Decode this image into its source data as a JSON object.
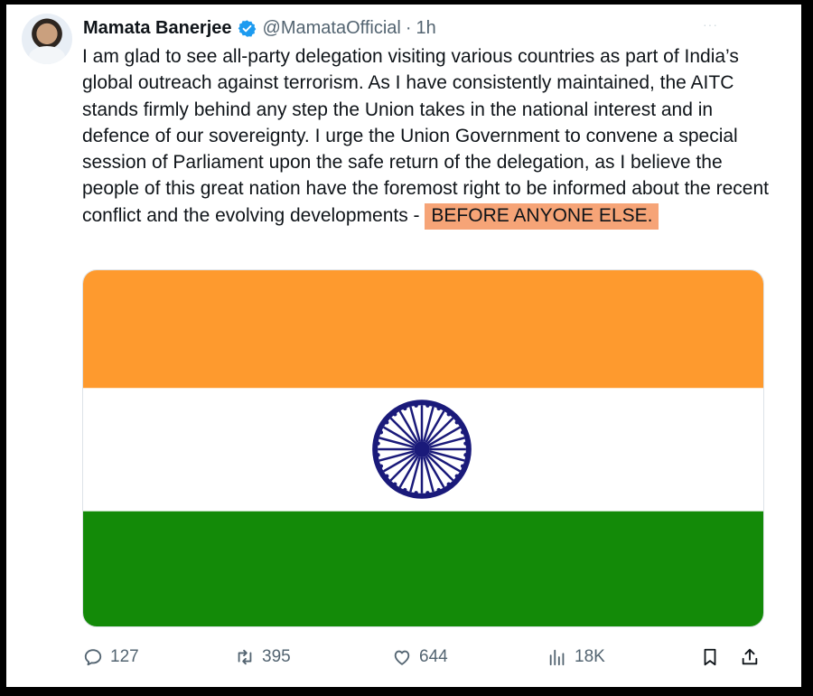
{
  "post": {
    "author_name": "Mamata Banerjee",
    "handle": "@MamataOfficial",
    "separator": "·",
    "timestamp": "1h",
    "text_main": "I am glad to see all-party delegation visiting various countries as part of India’s global outreach against terrorism. As I have consistently maintained, the AITC stands firmly behind any step the Union takes in the national interest and in defence of our sovereignty. I urge the Union Government to convene a special session of Parliament upon the safe return of the delegation, as I believe the people of this great nation have the foremost right to be informed about the recent conflict and the evolving developments - ",
    "text_highlight": "BEFORE ANYONE ELSE."
  },
  "media": {
    "type": "indian-flag",
    "colors": {
      "saffron": "#fe9a2e",
      "white": "#ffffff",
      "green": "#138a08",
      "chakra": "#1a1a7a"
    }
  },
  "actions": {
    "replies": "127",
    "reposts": "395",
    "likes": "644",
    "views": "18K"
  },
  "icons": [
    "verified-badge-icon",
    "reply-icon",
    "repost-icon",
    "like-icon",
    "views-icon",
    "bookmark-icon",
    "share-icon",
    "more-icon"
  ],
  "colors": {
    "text": "#0f1419",
    "secondary": "#536471",
    "highlight": "#f6a477",
    "verified": "#1d9bf0"
  }
}
